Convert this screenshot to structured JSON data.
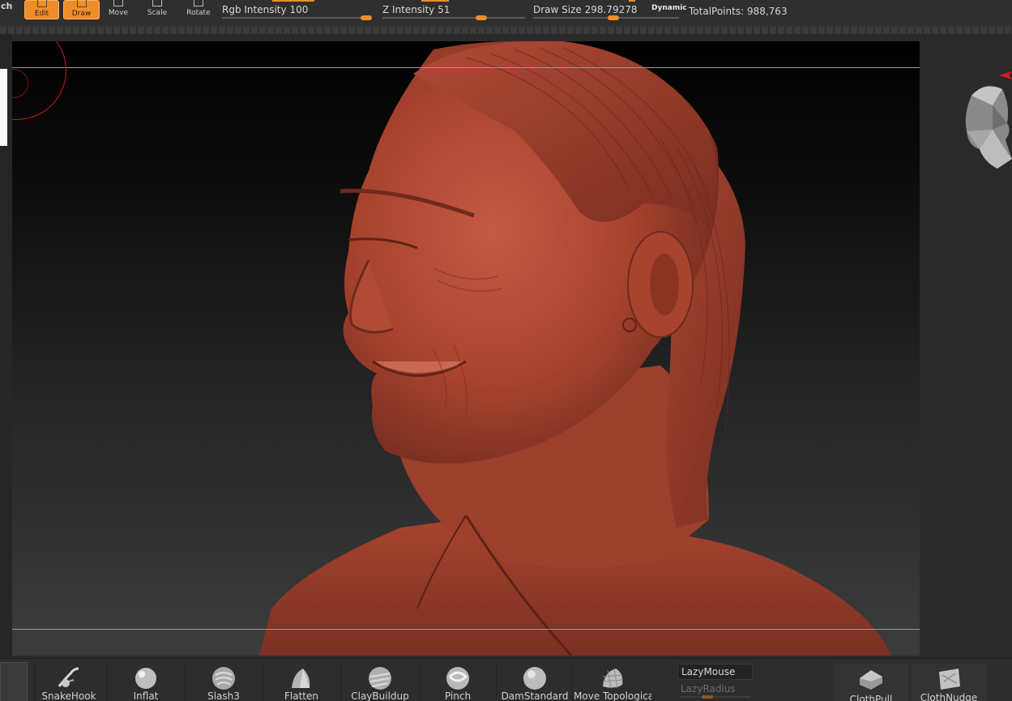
{
  "toolbar": {
    "app_fragment": "ch",
    "edit_label": "Edit",
    "draw_label": "Draw",
    "move_label": "Move",
    "scale_label": "Scale",
    "rotate_label": "Rotate",
    "rgb_intensity_label": "Rgb Intensity",
    "rgb_intensity_value": "100",
    "z_intensity_label": "Z Intensity",
    "z_intensity_value": "51",
    "draw_size_label": "Draw Size",
    "draw_size_value": "298.79278",
    "dynamic_label": "Dynamic",
    "total_points_label": "TotalPoints:",
    "total_points_value": "988,763"
  },
  "shelf": {
    "brushes": [
      {
        "label": ""
      },
      {
        "label": "SnakeHook"
      },
      {
        "label": "Inflat"
      },
      {
        "label": "Slash3"
      },
      {
        "label": "Flatten"
      },
      {
        "label": "ClayBuildup"
      },
      {
        "label": "Pinch"
      },
      {
        "label": "DamStandard"
      },
      {
        "label": "Move Topologica"
      }
    ],
    "lazymouse_label": "LazyMouse",
    "lazyradius_label": "LazyRadius",
    "cloth": [
      {
        "label": "ClothPull"
      },
      {
        "label": "ClothNudge"
      }
    ]
  },
  "colors": {
    "accent": "#f08c2a",
    "sculpt_material": "#b04a36",
    "cursor_ring": "#c41b1b"
  }
}
